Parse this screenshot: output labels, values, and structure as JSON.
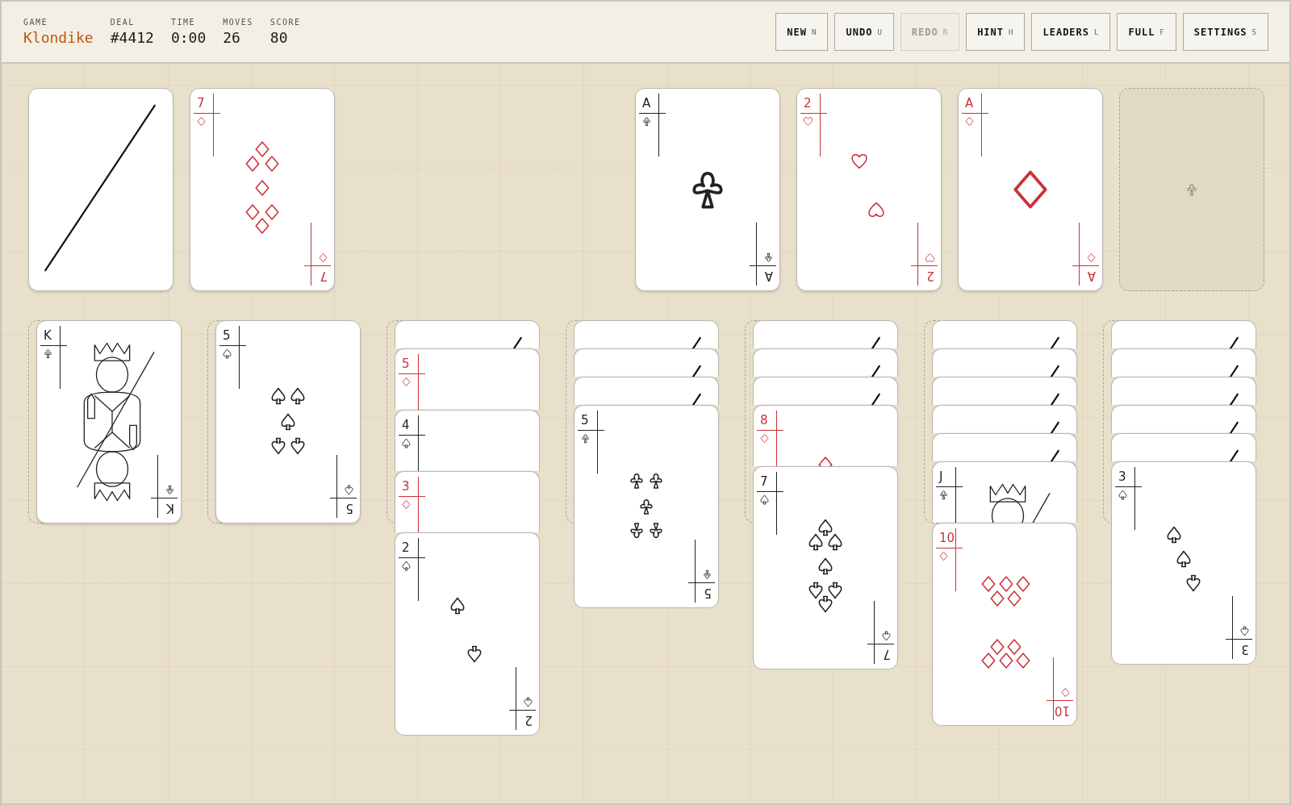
{
  "header": {
    "stats": [
      {
        "label": "GAME",
        "value": "Klondike",
        "kind": "title"
      },
      {
        "label": "DEAL",
        "value": "#4412",
        "kind": "plain"
      },
      {
        "label": "TIME",
        "value": "0:00",
        "kind": "plain"
      },
      {
        "label": "MOVES",
        "value": "26",
        "kind": "plain"
      },
      {
        "label": "SCORE",
        "value": "80",
        "kind": "plain"
      }
    ],
    "buttons": [
      {
        "label": "NEW",
        "key": "N",
        "disabled": false
      },
      {
        "label": "UNDO",
        "key": "U",
        "disabled": false
      },
      {
        "label": "REDO",
        "key": "R",
        "disabled": true
      },
      {
        "label": "HINT",
        "key": "H",
        "disabled": false
      },
      {
        "label": "LEADERS",
        "key": "L",
        "disabled": false
      },
      {
        "label": "FULL",
        "key": "F",
        "disabled": false
      },
      {
        "label": "SETTINGS",
        "key": "S",
        "disabled": false
      }
    ]
  },
  "stock": {
    "kind": "face_down"
  },
  "waste": {
    "kind": "face_up",
    "rank": "7",
    "suit": {
      "kind": "diamonds"
    },
    "rank_flipped": "7"
  },
  "foundations": [
    {
      "kind": "face_up",
      "rank": "A",
      "suit": {
        "kind": "clubs"
      },
      "rank_flipped": "A"
    },
    {
      "kind": "face_up",
      "rank": "2",
      "suit": {
        "kind": "hearts"
      },
      "rank_flipped": "2"
    },
    {
      "kind": "face_up",
      "rank": "A",
      "suit": {
        "kind": "diamonds"
      },
      "rank_flipped": "A"
    },
    {
      "kind": "empty",
      "suit": {
        "kind": "clubs"
      }
    }
  ],
  "tableau": [
    {
      "cards": [
        {
          "kind": "face_up",
          "rank": "K",
          "suit": {
            "kind": "clubs"
          },
          "rank_flipped": "K"
        }
      ]
    },
    {
      "cards": [
        {
          "kind": "face_up",
          "rank": "5",
          "suit": {
            "kind": "spades"
          },
          "rank_flipped": "5"
        }
      ]
    },
    {
      "cards": [
        {
          "kind": "face_down"
        },
        {
          "kind": "face_up",
          "rank": "5",
          "suit": {
            "kind": "diamonds"
          }
        },
        {
          "kind": "face_up",
          "rank": "4",
          "suit": {
            "kind": "spades"
          }
        },
        {
          "kind": "face_up",
          "rank": "3",
          "suit": {
            "kind": "diamonds"
          }
        },
        {
          "kind": "face_up",
          "rank": "2",
          "suit": {
            "kind": "spades"
          },
          "rank_flipped": "2"
        }
      ]
    },
    {
      "cards": [
        {
          "kind": "face_down"
        },
        {
          "kind": "face_down"
        },
        {
          "kind": "face_down"
        },
        {
          "kind": "face_up",
          "rank": "5",
          "suit": {
            "kind": "clubs"
          },
          "rank_flipped": "5"
        }
      ]
    },
    {
      "cards": [
        {
          "kind": "face_down"
        },
        {
          "kind": "face_down"
        },
        {
          "kind": "face_down"
        },
        {
          "kind": "face_up",
          "rank": "8",
          "suit": {
            "kind": "diamonds"
          }
        },
        {
          "kind": "face_up",
          "rank": "7",
          "suit": {
            "kind": "spades"
          },
          "rank_flipped": "7"
        }
      ]
    },
    {
      "cards": [
        {
          "kind": "face_down"
        },
        {
          "kind": "face_down"
        },
        {
          "kind": "face_down"
        },
        {
          "kind": "face_down"
        },
        {
          "kind": "face_down"
        },
        {
          "kind": "face_up",
          "rank": "J",
          "suit": {
            "kind": "clubs"
          }
        },
        {
          "kind": "face_up",
          "rank": "10",
          "suit": {
            "kind": "diamonds"
          },
          "rank_flipped": "10"
        }
      ]
    },
    {
      "cards": [
        {
          "kind": "face_down"
        },
        {
          "kind": "face_down"
        },
        {
          "kind": "face_down"
        },
        {
          "kind": "face_down"
        },
        {
          "kind": "face_down"
        },
        {
          "kind": "face_up",
          "rank": "3",
          "suit": {
            "kind": "spades"
          },
          "rank_flipped": "3"
        }
      ]
    }
  ]
}
